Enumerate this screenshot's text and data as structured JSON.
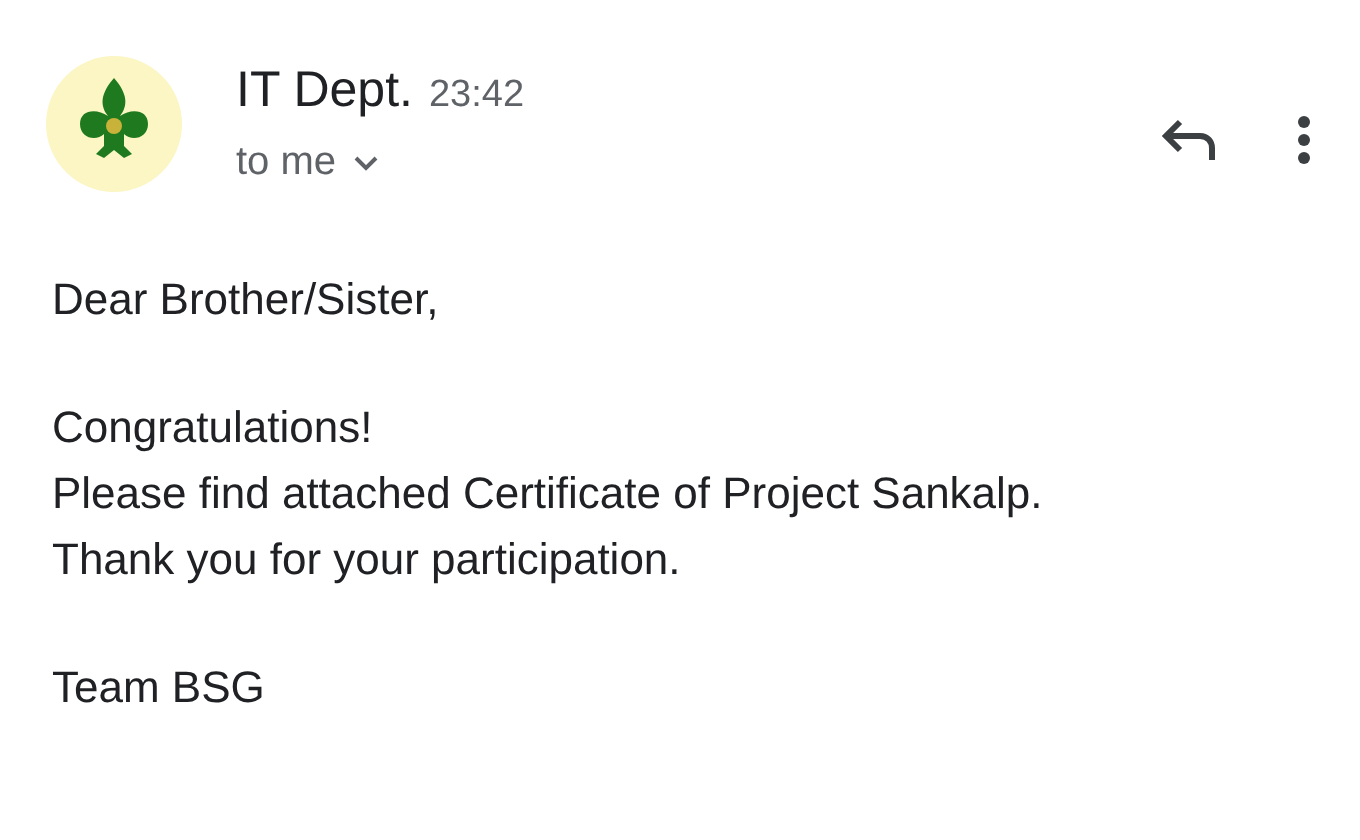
{
  "header": {
    "sender": "IT Dept.",
    "time": "23:42",
    "recipient": "to me"
  },
  "body": {
    "paragraphs": [
      [
        "Dear Brother/Sister,"
      ],
      [
        "Congratulations!",
        "Please find attached Certificate of Project Sankalp.",
        "Thank you for your participation."
      ],
      [
        "Team BSG"
      ]
    ]
  }
}
